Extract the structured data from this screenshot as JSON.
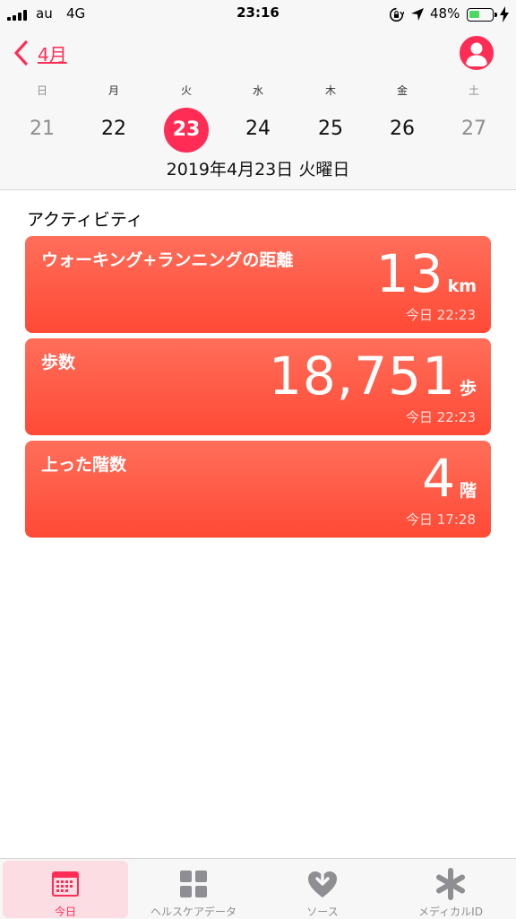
{
  "status": {
    "carrier": "au",
    "network": "4G",
    "time": "23:16",
    "battery": "48%",
    "battery_level": 0.48
  },
  "header": {
    "back_label": "4月",
    "weekdays": [
      "日",
      "月",
      "火",
      "水",
      "木",
      "金",
      "土"
    ],
    "dates": [
      "21",
      "22",
      "23",
      "24",
      "25",
      "26",
      "27"
    ],
    "selected_date": "23",
    "full_date": "2019年4月23日 火曜日"
  },
  "activity": {
    "section_title": "アクティビティ",
    "cards": [
      {
        "title": "ウォーキング+ランニングの距離",
        "value": "13",
        "unit": "km",
        "time": "今日 22:23"
      },
      {
        "title": "歩数",
        "value": "18,751",
        "unit": "歩",
        "time": "今日 22:23"
      },
      {
        "title": "上った階数",
        "value": "4",
        "unit": "階",
        "time": "今日 17:28"
      }
    ]
  },
  "tabs": [
    {
      "label": "今日",
      "icon": "calendar-icon",
      "active": true
    },
    {
      "label": "ヘルスケアデータ",
      "icon": "grid-icon",
      "active": false
    },
    {
      "label": "ソース",
      "icon": "heart-download-icon",
      "active": false
    },
    {
      "label": "メディカルID",
      "icon": "asterisk-icon",
      "active": false
    }
  ],
  "colors": {
    "accent": "#ff2d55",
    "card_top": "#ff6e5a",
    "card_bottom": "#ff4a36",
    "battery_fill": "#4cd964"
  }
}
